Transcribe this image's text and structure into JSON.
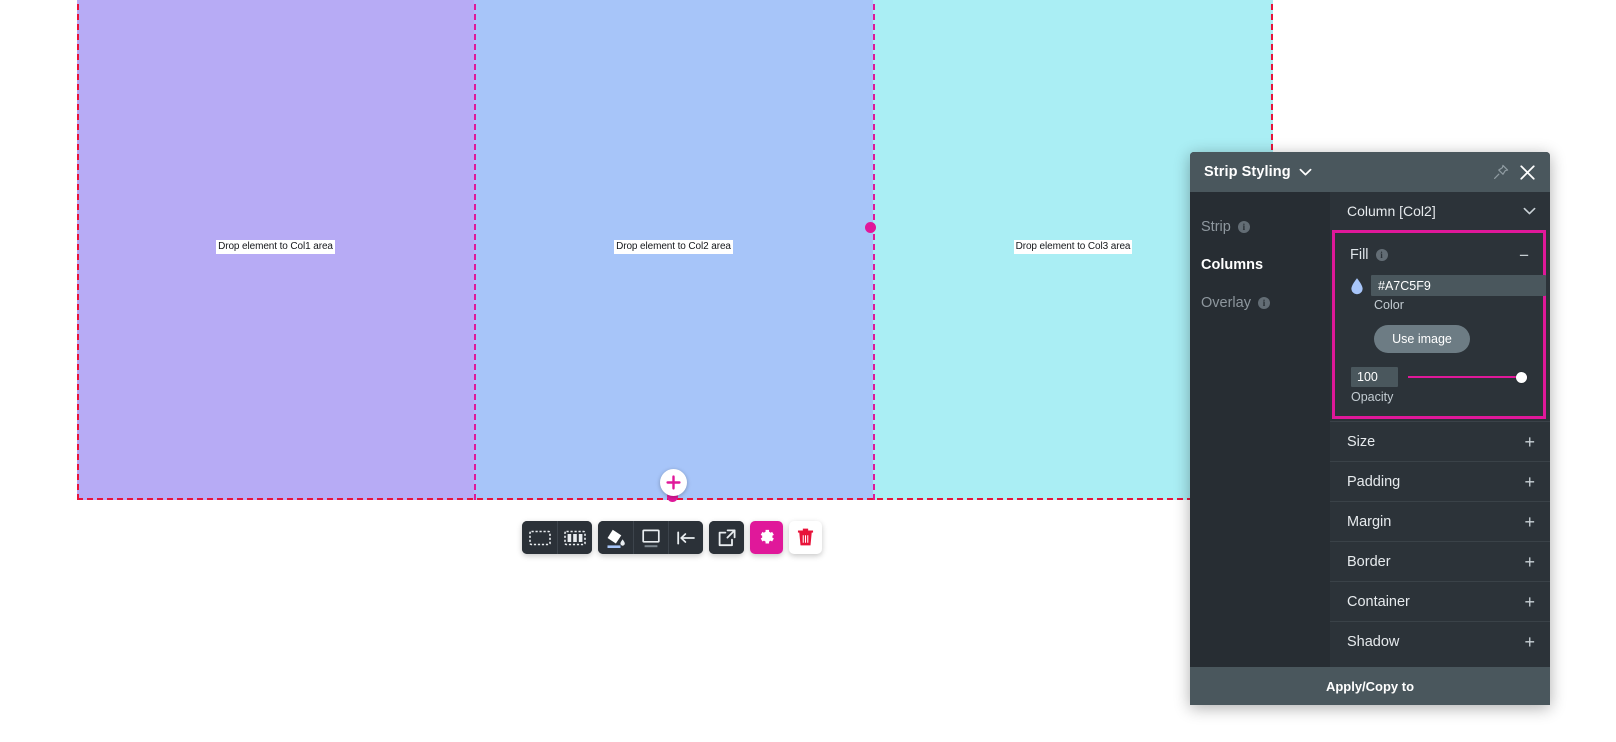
{
  "canvas": {
    "columns": [
      {
        "label": "Drop element to Col1 area",
        "color": "#b7abf5",
        "name": "Col1"
      },
      {
        "label": "Drop element to Col2 area",
        "color": "#a7c5f9",
        "name": "Col2"
      },
      {
        "label": "Drop element to Col3 area",
        "color": "#aaeef4",
        "name": "Col3"
      }
    ],
    "strip_outline_color": "#e8133a",
    "column_divider_color": "#e0189a",
    "add_button_label": "+"
  },
  "toolbar": {
    "items": [
      {
        "icon": "select-strip-icon",
        "label": "Select strip"
      },
      {
        "icon": "select-columns-icon",
        "label": "Select columns"
      },
      {
        "icon": "fill-color-icon",
        "label": "Fill color"
      },
      {
        "icon": "border-icon",
        "label": "Border"
      },
      {
        "icon": "align-left-icon",
        "label": "Align"
      },
      {
        "icon": "move-out-icon",
        "label": "Move out"
      },
      {
        "icon": "gear-icon",
        "label": "Settings"
      },
      {
        "icon": "trash-icon",
        "label": "Delete"
      }
    ],
    "accent_color": "#e0189a"
  },
  "panel": {
    "title": "Strip Styling",
    "caret_icon": "chevron-down-icon",
    "pin_icon": "pin-icon",
    "close_icon": "close-icon",
    "nav": [
      {
        "label": "Strip",
        "active": false,
        "info": "i"
      },
      {
        "label": "Columns",
        "active": true,
        "info": ""
      },
      {
        "label": "Overlay",
        "active": false,
        "info": "i"
      }
    ],
    "subhead": "Column [Col2]",
    "subhead_caret": "chevron-down-icon",
    "fill": {
      "title": "Fill",
      "info": "i",
      "collapse_symbol": "−",
      "color_value": "#A7C5F9",
      "color_caption": "Color",
      "color_icon": "droplet-icon",
      "contrast_icon": "contrast-icon",
      "use_image_label": "Use image",
      "opacity_value": "100",
      "opacity_caption": "Opacity",
      "slider_fill_color": "#e0189a",
      "highlight_color": "#e0189a"
    },
    "sections": [
      {
        "label": "Size",
        "expand_symbol": "+"
      },
      {
        "label": "Padding",
        "expand_symbol": "+"
      },
      {
        "label": "Margin",
        "expand_symbol": "+"
      },
      {
        "label": "Border",
        "expand_symbol": "+"
      },
      {
        "label": "Container",
        "expand_symbol": "+"
      },
      {
        "label": "Shadow",
        "expand_symbol": "+"
      }
    ],
    "footer_label": "Apply/Copy to"
  }
}
